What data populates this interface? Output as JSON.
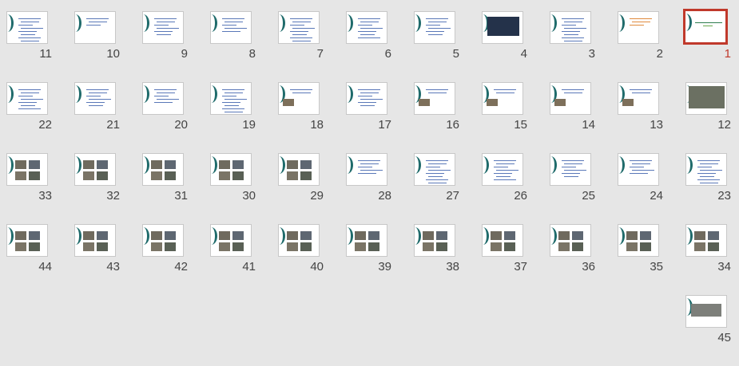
{
  "app": {
    "view": "Slide Sorter"
  },
  "selected_slide": "1",
  "colors": {
    "selection": "#c0392b",
    "background": "#e6e6e6",
    "accent": "#1f6b6b"
  },
  "rows": [
    {
      "slides": [
        {
          "num": "11",
          "kind": "text"
        },
        {
          "num": "10",
          "kind": "title"
        },
        {
          "num": "9",
          "kind": "text"
        },
        {
          "num": "8",
          "kind": "text"
        },
        {
          "num": "7",
          "kind": "text"
        },
        {
          "num": "6",
          "kind": "text"
        },
        {
          "num": "5",
          "kind": "text"
        },
        {
          "num": "4",
          "kind": "photo"
        },
        {
          "num": "3",
          "kind": "text"
        },
        {
          "num": "2",
          "kind": "title"
        },
        {
          "num": "1",
          "kind": "title"
        }
      ]
    },
    {
      "slides": [
        {
          "num": "22",
          "kind": "text"
        },
        {
          "num": "21",
          "kind": "text"
        },
        {
          "num": "20",
          "kind": "text"
        },
        {
          "num": "19",
          "kind": "text"
        },
        {
          "num": "18",
          "kind": "photo"
        },
        {
          "num": "17",
          "kind": "text"
        },
        {
          "num": "16",
          "kind": "photo"
        },
        {
          "num": "15",
          "kind": "photo"
        },
        {
          "num": "14",
          "kind": "photo"
        },
        {
          "num": "13",
          "kind": "photo"
        },
        {
          "num": "12",
          "kind": "photo"
        }
      ]
    },
    {
      "slides": [
        {
          "num": "33",
          "kind": "grid"
        },
        {
          "num": "32",
          "kind": "grid"
        },
        {
          "num": "31",
          "kind": "grid"
        },
        {
          "num": "30",
          "kind": "grid"
        },
        {
          "num": "29",
          "kind": "grid"
        },
        {
          "num": "28",
          "kind": "text"
        },
        {
          "num": "27",
          "kind": "text"
        },
        {
          "num": "26",
          "kind": "text"
        },
        {
          "num": "25",
          "kind": "text"
        },
        {
          "num": "24",
          "kind": "text"
        },
        {
          "num": "23",
          "kind": "text"
        }
      ]
    },
    {
      "slides": [
        {
          "num": "44",
          "kind": "grid"
        },
        {
          "num": "43",
          "kind": "grid"
        },
        {
          "num": "42",
          "kind": "grid"
        },
        {
          "num": "41",
          "kind": "grid"
        },
        {
          "num": "40",
          "kind": "grid"
        },
        {
          "num": "39",
          "kind": "grid"
        },
        {
          "num": "38",
          "kind": "grid"
        },
        {
          "num": "37",
          "kind": "grid"
        },
        {
          "num": "36",
          "kind": "grid"
        },
        {
          "num": "35",
          "kind": "grid"
        },
        {
          "num": "34",
          "kind": "grid"
        }
      ]
    },
    {
      "slides": [
        {
          "num": "",
          "kind": "empty"
        },
        {
          "num": "",
          "kind": "empty"
        },
        {
          "num": "",
          "kind": "empty"
        },
        {
          "num": "",
          "kind": "empty"
        },
        {
          "num": "",
          "kind": "empty"
        },
        {
          "num": "",
          "kind": "empty"
        },
        {
          "num": "",
          "kind": "empty"
        },
        {
          "num": "",
          "kind": "empty"
        },
        {
          "num": "",
          "kind": "empty"
        },
        {
          "num": "",
          "kind": "empty"
        },
        {
          "num": "45",
          "kind": "photo"
        }
      ]
    }
  ]
}
